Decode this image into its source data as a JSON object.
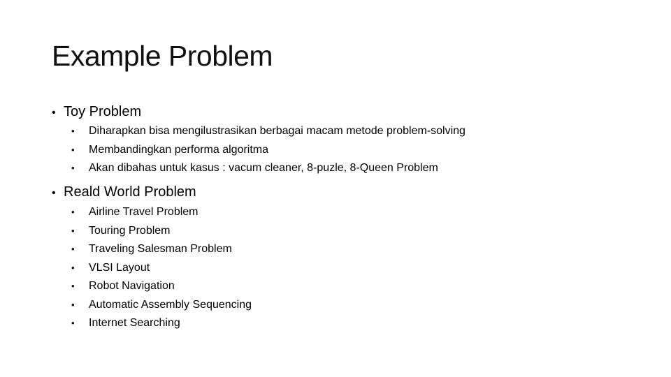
{
  "slide": {
    "title": "Example Problem",
    "bullet_glyph": "•",
    "sections": [
      {
        "heading": "Toy Problem",
        "items": [
          "Diharapkan bisa mengilustrasikan berbagai macam metode problem-solving",
          "Membandingkan performa algoritma",
          "Akan dibahas untuk kasus : vacum cleaner, 8-puzle, 8-Queen Problem"
        ]
      },
      {
        "heading": "Reald World Problem",
        "items": [
          "Airline Travel Problem",
          "Touring Problem",
          "Traveling Salesman Problem",
          "VLSI Layout",
          "Robot Navigation",
          "Automatic Assembly Sequencing",
          "Internet Searching"
        ]
      }
    ]
  }
}
